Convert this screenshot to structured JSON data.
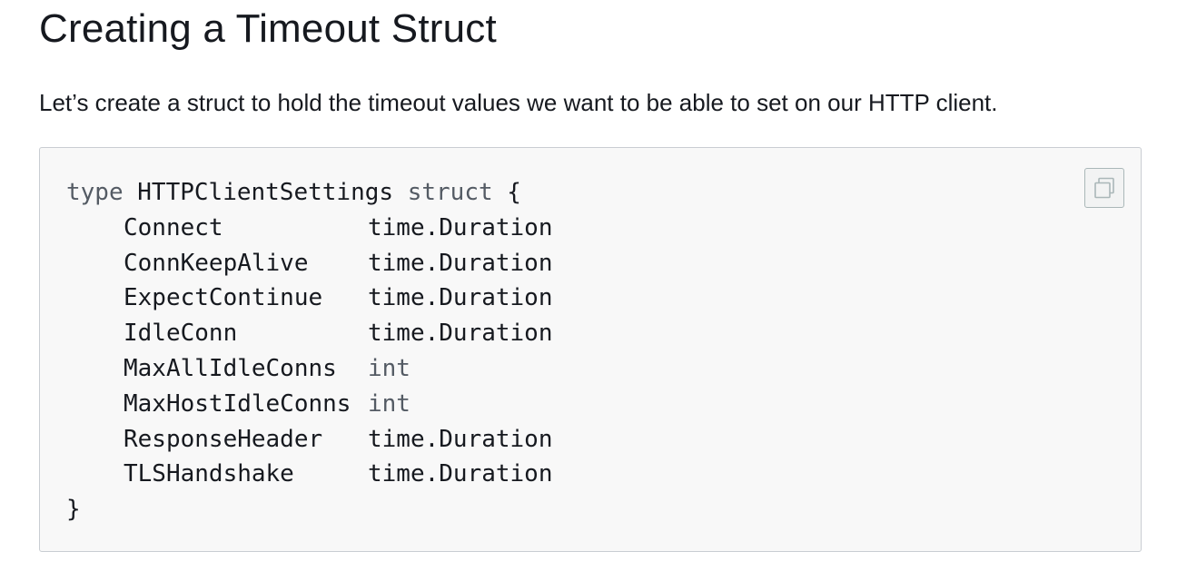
{
  "heading": "Creating a Timeout Struct",
  "intro": "Let’s create a struct to hold the timeout values we want to be able to set on our HTTP client.",
  "code": {
    "open": {
      "keyword": "type",
      "name": " HTTPClientSettings ",
      "kind": "struct",
      "brace": " {"
    },
    "fields": [
      {
        "name": "Connect",
        "type": "time.Duration"
      },
      {
        "name": "ConnKeepAlive",
        "type": "time.Duration"
      },
      {
        "name": "ExpectContinue",
        "type": "time.Duration"
      },
      {
        "name": "IdleConn",
        "type": "time.Duration"
      },
      {
        "name": "MaxAllIdleConns",
        "type": "int"
      },
      {
        "name": "MaxHostIdleConns",
        "type": "int"
      },
      {
        "name": "ResponseHeader",
        "type": "time.Duration"
      },
      {
        "name": "TLSHandshake",
        "type": "time.Duration"
      }
    ],
    "close": "}"
  },
  "copy_button": {
    "icon": "copy-icon"
  },
  "colors": {
    "text": "#16191f",
    "keyword": "#545b64",
    "code_bg": "#f8f8f8",
    "code_border": "#c9cdd2"
  }
}
